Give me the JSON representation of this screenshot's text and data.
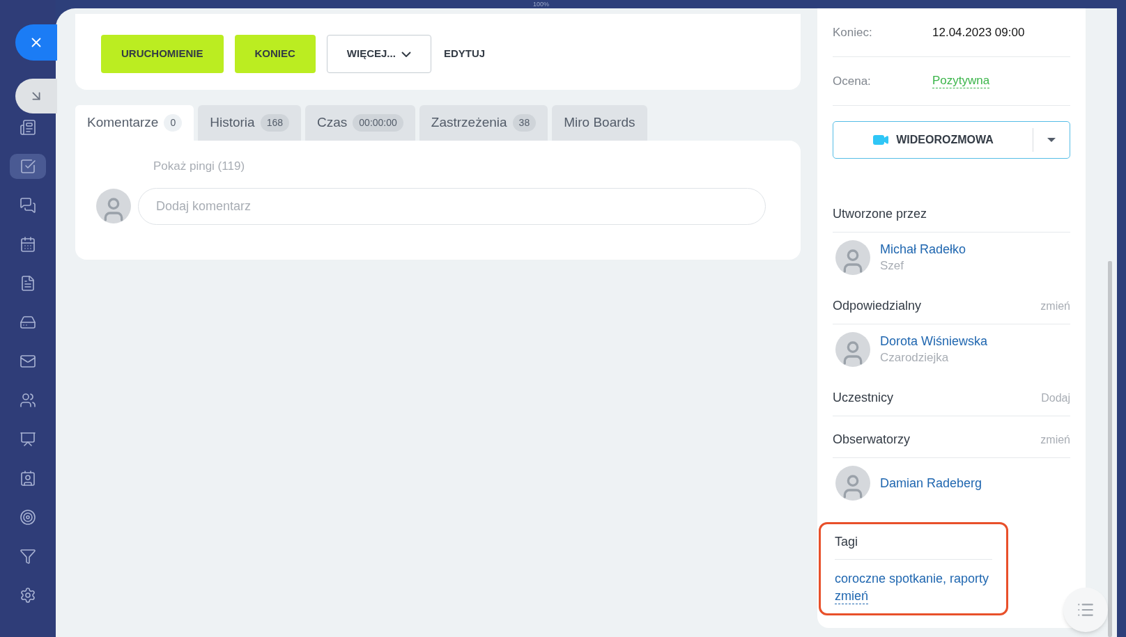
{
  "zoom_indicator": "100%",
  "sidebar": {
    "items": [
      {
        "kind": "feed",
        "selected": false
      },
      {
        "kind": "tasks",
        "selected": true
      },
      {
        "kind": "chat",
        "selected": false
      },
      {
        "kind": "calendar",
        "selected": false
      },
      {
        "kind": "document",
        "selected": false
      },
      {
        "kind": "drive",
        "selected": false
      },
      {
        "kind": "mail",
        "selected": false
      },
      {
        "kind": "contacts",
        "selected": false
      },
      {
        "kind": "board",
        "selected": false
      },
      {
        "kind": "card",
        "selected": false
      },
      {
        "kind": "target",
        "selected": false
      },
      {
        "kind": "funnel",
        "selected": false
      },
      {
        "kind": "settings",
        "selected": false
      }
    ]
  },
  "actions": [
    {
      "label": "URUCHOMIENIE",
      "kind": "primary"
    },
    {
      "label": "KONIEC",
      "kind": "primary"
    },
    {
      "label": "WIĘCEJ...",
      "kind": "dropdown"
    },
    {
      "label": "EDYTUJ",
      "kind": "link"
    }
  ],
  "tabs": [
    {
      "label": "Komentarze",
      "count": "0",
      "selected": true
    },
    {
      "label": "Historia",
      "count": "168",
      "selected": false
    },
    {
      "label": "Czas",
      "count": "00:00:00",
      "selected": false
    },
    {
      "label": "Zastrzeżenia",
      "count": "38",
      "selected": false
    },
    {
      "label": "Miro Boards",
      "selected": false
    }
  ],
  "comments": {
    "show_pings": "Pokaż pingi (119)",
    "input": {
      "placeholder": "Dodaj komentarz"
    }
  },
  "details": [
    {
      "label": "Koniec:",
      "value": "12.04.2023 09:00",
      "kind": "plain"
    },
    {
      "label": "Ocena:",
      "value": "Pozytywna",
      "kind": "rating"
    }
  ],
  "video_call": {
    "label": "WIDEOROZMOWA"
  },
  "people_sections": [
    {
      "title": "Utworzone przez",
      "people": [
        {
          "name": "Michał Radełko",
          "role": "Szef"
        }
      ]
    },
    {
      "title": "Odpowiedzialny",
      "action": "zmień",
      "people": [
        {
          "name": "Dorota Wiśniewska",
          "role": "Czarodziejka"
        }
      ]
    },
    {
      "title": "Uczestnicy",
      "action": "Dodaj"
    },
    {
      "title": "Obserwatorzy",
      "action": "zmień",
      "people": [
        {
          "name": "Damian Radeberg"
        }
      ]
    }
  ],
  "tags": {
    "title": "Tagi",
    "values": "coroczne spotkanie, raporty",
    "action": "zmień",
    "highlighted": true
  }
}
